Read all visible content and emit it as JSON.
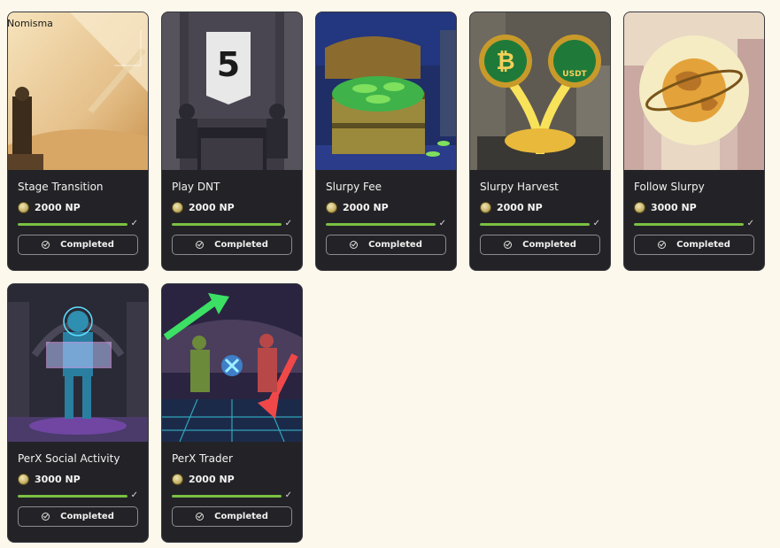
{
  "app": {
    "brand": "Nomisma"
  },
  "quests": [
    {
      "title": "Stage Transition",
      "reward": "2000 NP",
      "progress": 1.0,
      "status": "Completed",
      "image_icon": "desert-warrior-icon"
    },
    {
      "title": "Play DNT",
      "reward": "2000 NP",
      "progress": 1.0,
      "status": "Completed",
      "image_icon": "chess-knights-icon"
    },
    {
      "title": "Slurpy Fee",
      "reward": "2000 NP",
      "progress": 1.0,
      "status": "Completed",
      "image_icon": "treasure-chest-icon"
    },
    {
      "title": "Slurpy Harvest",
      "reward": "2000 NP",
      "progress": 1.0,
      "status": "Completed",
      "image_icon": "crypto-coins-icon"
    },
    {
      "title": "Follow Slurpy",
      "reward": "3000 NP",
      "progress": 1.0,
      "status": "Completed",
      "image_icon": "globe-icon"
    },
    {
      "title": "PerX Social Activity",
      "reward": "3000 NP",
      "progress": 1.0,
      "status": "Completed",
      "image_icon": "cyber-warrior-icon"
    },
    {
      "title": "PerX Trader",
      "reward": "2000 NP",
      "progress": 1.0,
      "status": "Completed",
      "image_icon": "trading-gladiators-icon"
    }
  ],
  "banner_logo_text": "5",
  "coin_labels": {
    "left": "₿",
    "right": "USDT"
  },
  "colors": {
    "progress_fill": "#7bc142",
    "card_bg": "#232327",
    "page_bg": "#fdf8ec"
  }
}
